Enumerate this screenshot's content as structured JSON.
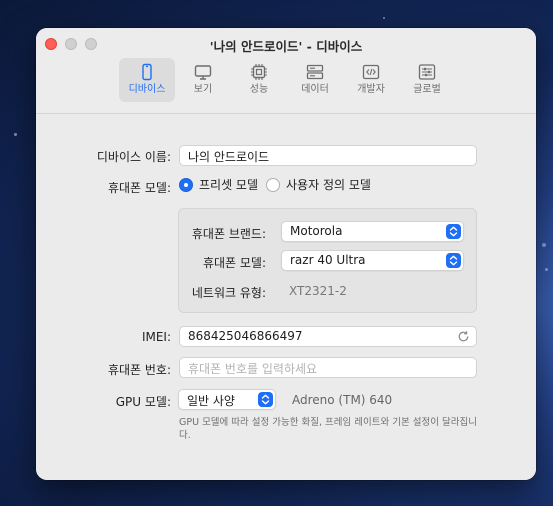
{
  "window": {
    "title": "'나의 안드로이드' - 디바이스"
  },
  "toolbar": {
    "tabs": [
      {
        "label": "디바이스",
        "icon": "phone-icon",
        "active": true
      },
      {
        "label": "보기",
        "icon": "display-icon",
        "active": false
      },
      {
        "label": "성능",
        "icon": "cpu-icon",
        "active": false
      },
      {
        "label": "데이터",
        "icon": "drive-icon",
        "active": false
      },
      {
        "label": "개발자",
        "icon": "code-icon",
        "active": false
      },
      {
        "label": "글로벌",
        "icon": "sliders-icon",
        "active": false
      }
    ]
  },
  "form": {
    "device_name_label": "디바이스 이름:",
    "device_name_value": "나의 안드로이드",
    "phone_model_label": "휴대폰 모델:",
    "radio_preset_label": "프리셋 모델",
    "radio_custom_label": "사용자 정의 모델",
    "preset": {
      "brand_label": "휴대폰 브랜드:",
      "brand_value": "Motorola",
      "model_label": "휴대폰 모델:",
      "model_value": "razr 40 Ultra",
      "network_label": "네트워크 유형:",
      "network_value": "XT2321-2"
    },
    "imei_label": "IMEI:",
    "imei_value": "868425046866497",
    "phone_number_label": "휴대폰 번호:",
    "phone_number_placeholder": "휴대폰 번호를 입력하세요",
    "gpu_label": "GPU 모델:",
    "gpu_popup_value": "일반 사양",
    "gpu_name": "Adreno (TM) 640",
    "gpu_hint": "GPU 모델에 따라 설정 가능한 화질, 프레임 레이트와 기본 설정이 달라집니다."
  },
  "colors": {
    "accent": "#1f6ff5",
    "close_button": "#ff5f57"
  }
}
